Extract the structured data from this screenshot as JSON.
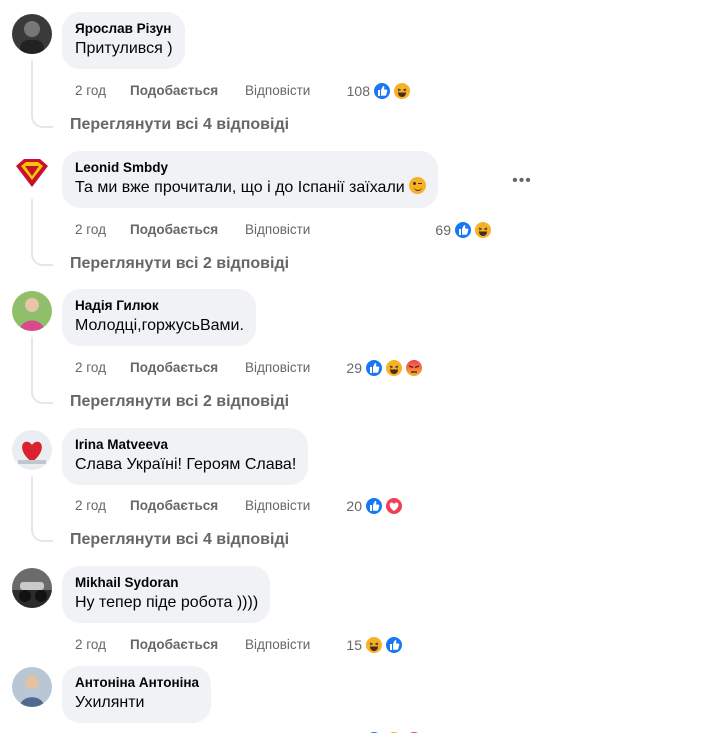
{
  "comments": [
    {
      "author": "Ярослав Різун",
      "text": "Притулився )",
      "time": "2 год",
      "like": "Подобається",
      "reply": "Відповісти",
      "count": "108",
      "replies": "Переглянути всі 4 відповіді"
    },
    {
      "author": "Leonid Smbdy",
      "text": "Та ми вже прочитали, що і до Іспанії заїхали",
      "time": "2 год",
      "like": "Подобається",
      "reply": "Відповісти",
      "count": "69",
      "replies": "Переглянути всі 2 відповіді"
    },
    {
      "author": "Надія Гилюк",
      "text": "Молодці,горжусьВами.",
      "time": "2 год",
      "like": "Подобається",
      "reply": "Відповісти",
      "count": "29",
      "replies": "Переглянути всі 2 відповіді"
    },
    {
      "author": "Irina Matveeva",
      "text": "Слава Україні! Героям Слава!",
      "time": "2 год",
      "like": "Подобається",
      "reply": "Відповісти",
      "count": "20",
      "replies": "Переглянути всі 4 відповіді"
    },
    {
      "author": "Mikhail Sydoran",
      "text": "Ну тепер піде робота ))))",
      "time": "2 год",
      "like": "Подобається",
      "reply": "Відповісти",
      "count": "15"
    },
    {
      "author": "Антоніна Антоніна",
      "text": "Ухилянти"
    }
  ],
  "more_icon": "more-horizontal-icon",
  "colors": {
    "bubble": "#f0f2f5",
    "meta": "#65676b",
    "like_blue": "#1877f2",
    "haha_yellow": "#f7b125",
    "love_red": "#f33e58",
    "angry_orange": "#e9710f"
  }
}
